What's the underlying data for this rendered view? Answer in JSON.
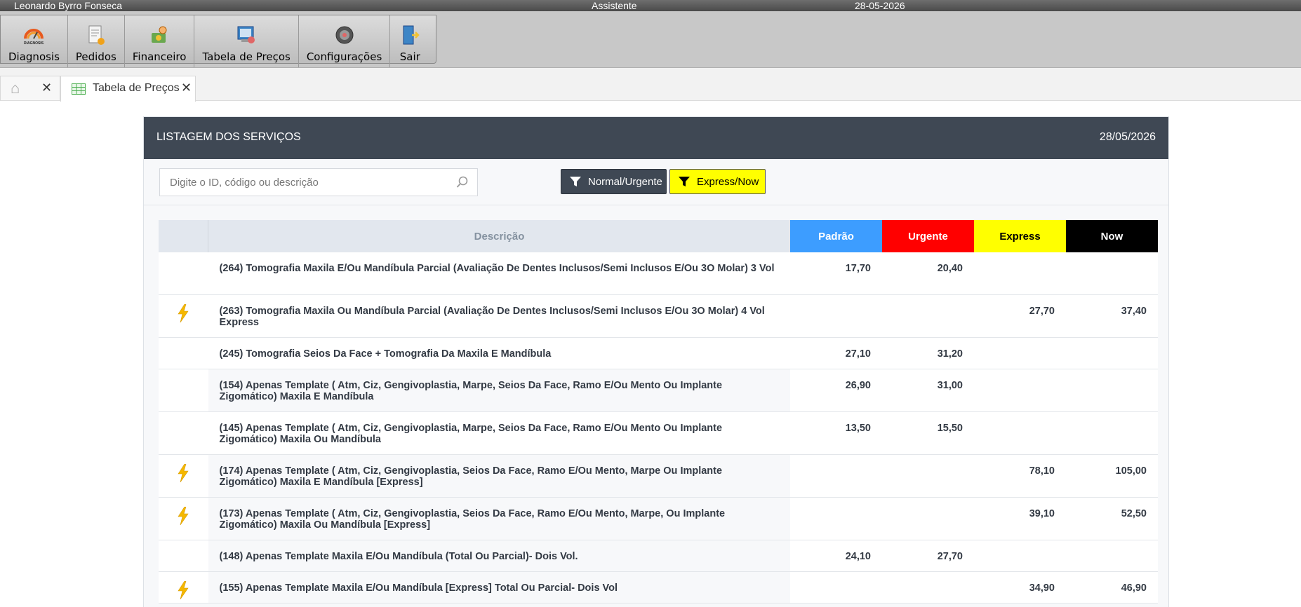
{
  "topbar": {
    "user": "Leonardo Byrro Fonseca",
    "role": "Assistente",
    "date": "28-05-2026"
  },
  "toolbar": {
    "items": [
      {
        "label": "Diagnosis",
        "icon": "diagnosis-logo-icon"
      },
      {
        "label": "Pedidos",
        "icon": "orders-icon"
      },
      {
        "label": "Financeiro",
        "icon": "finance-icon"
      },
      {
        "label": "Tabela de Preços",
        "icon": "price-table-icon"
      },
      {
        "label": "Configurações",
        "icon": "settings-icon"
      },
      {
        "label": "Sair",
        "icon": "exit-icon"
      }
    ],
    "logo_text": "DIAGNOSIS"
  },
  "tabs": {
    "active_label": "Tabela de Preços"
  },
  "panel": {
    "title": "LISTAGEM DOS SERVIÇOS",
    "date": "28/05/2026"
  },
  "search": {
    "placeholder": "Digite o ID, código ou descrição"
  },
  "filters": {
    "normal_label": "Normal/Urgente",
    "express_label": "Express/Now"
  },
  "table": {
    "headers": {
      "desc": "Descrição",
      "padrao": "Padrão",
      "urgente": "Urgente",
      "express": "Express",
      "now": "Now"
    },
    "rows": [
      {
        "desc": "(264) Tomografia Maxila E/Ou Mandíbula Parcial (Avaliação De Dentes Inclusos/Semi Inclusos E/Ou 3O Molar) 3 Vol",
        "padrao": "17,70",
        "urgente": "20,40",
        "express": "",
        "now": "",
        "bolt": false
      },
      {
        "desc": "(263) Tomografia Maxila Ou Mandíbula Parcial (Avaliação De Dentes Inclusos/Semi Inclusos E/Ou 3O Molar) 4 Vol Express",
        "padrao": "",
        "urgente": "",
        "express": "27,70",
        "now": "37,40",
        "bolt": true
      },
      {
        "desc": "(245) Tomografia Seios Da Face + Tomografia Da Maxila E Mandíbula",
        "padrao": "27,10",
        "urgente": "31,20",
        "express": "",
        "now": "",
        "bolt": false
      },
      {
        "desc": "(154) Apenas Template ( Atm, Ciz, Gengivoplastia, Marpe, Seios Da Face, Ramo E/Ou Mento Ou Implante Zigomático) Maxila E Mandíbula",
        "padrao": "26,90",
        "urgente": "31,00",
        "express": "",
        "now": "",
        "bolt": false
      },
      {
        "desc": "(145) Apenas Template ( Atm, Ciz, Gengivoplastia, Marpe, Seios Da Face, Ramo E/Ou Mento Ou Implante Zigomático) Maxila Ou Mandíbula",
        "padrao": "13,50",
        "urgente": "15,50",
        "express": "",
        "now": "",
        "bolt": false
      },
      {
        "desc": "(174) Apenas Template ( Atm, Ciz, Gengivoplastia, Seios Da Face, Ramo E/Ou Mento, Marpe Ou Implante Zigomático) Maxila E Mandíbula [Express]",
        "padrao": "",
        "urgente": "",
        "express": "78,10",
        "now": "105,00",
        "bolt": true
      },
      {
        "desc": "(173) Apenas Template ( Atm, Ciz, Gengivoplastia, Seios Da Face, Ramo E/Ou Mento, Marpe, Ou Implante Zigomático) Maxila Ou Mandíbula [Express]",
        "padrao": "",
        "urgente": "",
        "express": "39,10",
        "now": "52,50",
        "bolt": true
      },
      {
        "desc": "(148) Apenas Template Maxila E/Ou Mandíbula (Total Ou Parcial)- Dois Vol.",
        "padrao": "24,10",
        "urgente": "27,70",
        "express": "",
        "now": "",
        "bolt": false
      },
      {
        "desc": "(155) Apenas Template Maxila E/Ou Mandíbula [Express] Total Ou Parcial- Dois Vol",
        "padrao": "",
        "urgente": "",
        "express": "34,90",
        "now": "46,90",
        "bolt": true
      }
    ]
  },
  "colors": {
    "padrao": "#3d9dff",
    "urgente": "#ff0000",
    "express": "#ffff00",
    "now": "#000000",
    "header_bg": "#3f4854",
    "bolt": "#f5b800"
  }
}
